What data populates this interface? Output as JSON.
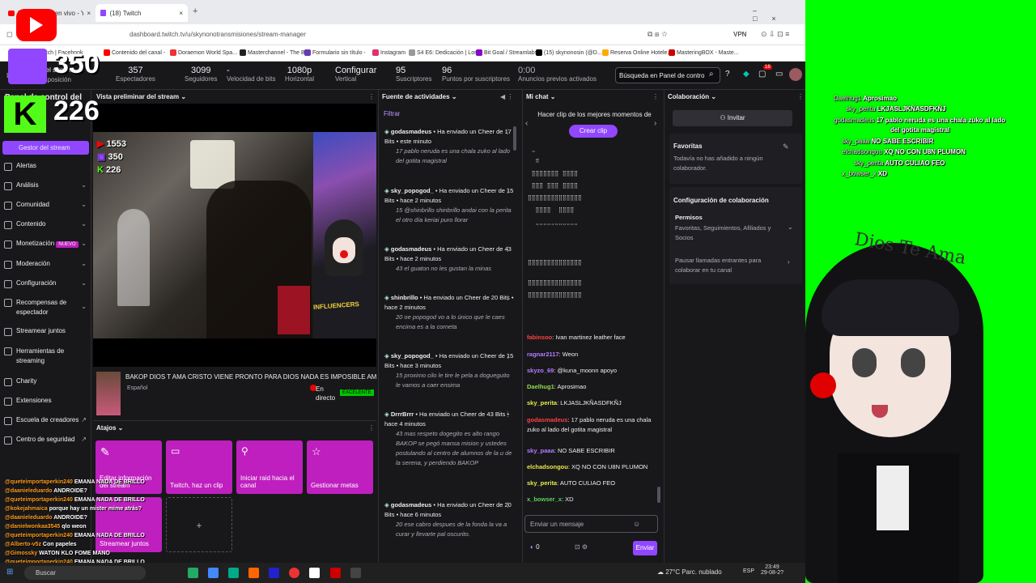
{
  "browser": {
    "tabs": [
      {
        "label": "Transmisión en vivo - YouTube"
      },
      {
        "label": "(18) Twitch"
      }
    ],
    "url": "dashboard.twitch.tv/u/skynonotransmisiones/stream-manager",
    "vpn": "VPN",
    "bookmarks": [
      "(22+) Watch | Facebook",
      "Contenido del canal -",
      "Doraemon World Spa...",
      "Masterchannel - The B...",
      "Formulario sin título -",
      "Instagram",
      "S4 E6: Dedicación | Los...",
      "Bit Goal / Streamlabs",
      "(15) skynonosin (@D...",
      "Reserva Online Hotele...",
      "MasteringBOX - Maste..."
    ]
  },
  "stream_counters": {
    "youtube": "1553",
    "twitch": "350",
    "kick": "226",
    "twitch_big": "350",
    "kick_big": "226"
  },
  "header": {
    "title_line1": "Gestor del stream",
    "title_line2": "Disposición",
    "stats": [
      {
        "value": "357",
        "label": "Espectadores"
      },
      {
        "value": "3099",
        "label": "Seguidores"
      },
      {
        "value": "-",
        "label": "Velocidad de bits"
      },
      {
        "value": "1080p",
        "label": "Horizontal"
      },
      {
        "value": "Configurar",
        "label": "Vertical"
      },
      {
        "value": "95",
        "label": "Suscriptores"
      },
      {
        "value": "96",
        "label": "Puntos por suscriptores"
      },
      {
        "value": "0:00",
        "label": "Anuncios previos activados"
      }
    ],
    "search_placeholder": "Búsqueda en Panel de contro",
    "notif_count": "18"
  },
  "sidebar": {
    "title": "Panel de control del creador",
    "items": [
      {
        "label": "Gestor del stream"
      },
      {
        "label": "Alertas"
      },
      {
        "label": "Análisis"
      },
      {
        "label": "Comunidad"
      },
      {
        "label": "Contenido"
      },
      {
        "label": "Monetización",
        "badge": "NUEVO"
      },
      {
        "label": "Moderación"
      },
      {
        "label": "Configuración"
      },
      {
        "label": "Recompensas de espectador"
      },
      {
        "label": "Streamear juntos"
      },
      {
        "label": "Herramientas de streaming"
      },
      {
        "label": "Charity"
      },
      {
        "label": "Extensiones"
      },
      {
        "label": "Escuela de creadores"
      },
      {
        "label": "Centro de seguridad"
      }
    ]
  },
  "preview": {
    "header": "Vista preliminar del stream",
    "watermark": "INFLUENCERS",
    "stream_title": "BAKOP DIOS T AMA CRISTO VIENE PRONTO PARA DIOS NADA ES IMPOSIBLE AMEN NUEVA",
    "language": "Español",
    "live": "En directo",
    "category_badge": "EXCELENTE"
  },
  "actions": {
    "header": "Atajos",
    "items": [
      {
        "label": "Editar información del stream"
      },
      {
        "label": "Twitch, haz un clip"
      },
      {
        "label": "Iniciar raid hacia el canal"
      },
      {
        "label": "Gestionar metas"
      },
      {
        "label": "Streamear juntos"
      }
    ]
  },
  "activity": {
    "header": "Fuente de actividades",
    "filter": "Filtrar",
    "events": [
      {
        "user": "godasmadeus",
        "text": "Ha enviado un Cheer de 17 Bits • este minuto",
        "msg": "17 pablo neruda es una chala zuko al lado del gotita magistral"
      },
      {
        "user": "sky_popogod_",
        "text": "Ha enviado un Cheer de 15 Bits • hace 2 minutos",
        "msg": "15 @shinbrillo shinbrillo andai con la perita el otro día keriai puro llorar"
      },
      {
        "user": "godasmadeus",
        "text": "Ha enviado un Cheer de 43 Bits • hace 2 minutos",
        "msg": "43 el guaton no les gustan la minas"
      },
      {
        "user": "shinbrillo",
        "text": "Ha enviado un Cheer de 20 Bits • hace 2 minutos",
        "msg": "20 oe popogod vo a lo único que le caes encima es a la corneta"
      },
      {
        "user": "sky_popogod_",
        "text": "Ha enviado un Cheer de 15 Bits • hace 3 minutos",
        "msg": "15 proximo cilo le tire le pela a dogueguito le vamos a caer ensima"
      },
      {
        "user": "DrrrBrrr",
        "text": "Ha enviado un Cheer de 43 Bits • hace 4 minutos",
        "msg": "43 mas respeto dogegito es alto rango BAKOP se pegó mansa mision y ustedes postulando al centro de alumnos de la u de la serena, y perdiendo BAKOP"
      },
      {
        "user": "godasmadeus",
        "text": "Ha enviado un Cheer de 20 Bits • hace 6 minutos",
        "msg": "20 ese cabro despues de la fonda la va a curar y llevarte pal oscurito."
      }
    ]
  },
  "chat": {
    "header": "Mi chat",
    "clip_prompt": "Hacer clip de los mejores momentos de",
    "clip_button": "Crear clip",
    "ascii": [
      "⠀⣀⠀⠀⠀⠀⠀⠀⠀⠀⠀⠀⠀⠀",
      "⠀⠀⠿⠀⠀⠀⠀⠀⠀⠀⠀⠀⠀",
      "⠀⣿⣿⣿⣿⣿⣿⣿⠀⣿⣿⣿⣿⠀",
      "⠀⣿⣿⣿⠀⣿⣿⣿⠀⣿⣿⣿⣿⠀",
      "⣿⣿⣿⣿⣿⣿⣿⣿⣿⣿⣿⣿⣿⣿",
      "⠀⠀⣿⣿⣿⣿⠀⠀⣿⣿⣿⣿⠀⠀",
      "⠀⠀⣀⣀⣀⣀⣀⣀⣀⣀⣀⣀⣀⠀",
      "⣿⣿⣿⣿⣿⣿⣿⣿⣿⣿⣿⣿⣿⣿",
      "⣿⣿⣿⣿⣿⣿⣿⣿⣿⣿⣿⣿⣿⣿",
      "⣿⣿⣿⣿⣿⣿⣿⣿⣿⣿⣿⣿⣿⣿"
    ],
    "messages": [
      {
        "user": "fabinsoo",
        "color": "#ff4040",
        "text": ": Ivan martinez leather face"
      },
      {
        "user": "ragnar2117",
        "color": "#b57bff",
        "text": ": Weon"
      },
      {
        "user": "skyzo_69",
        "color": "#b57bff",
        "text": ": @kuna_moonn apoyo"
      },
      {
        "user": "Daelhug1",
        "color": "#8fdc4e",
        "text": ": Aprosimao"
      },
      {
        "user": "sky_perita",
        "color": "#e8e84a",
        "text": ": LKJASLJKÑASDFKÑJ"
      },
      {
        "user": "godasmadeus",
        "color": "#ff4040",
        "text": ": 17 pablo neruda es una chala zuko al lado del gotita magistral"
      },
      {
        "user": "sky_paaa",
        "color": "#b57bff",
        "text": ": NO SABE ESCRIBIR"
      },
      {
        "user": "elchadsongou",
        "color": "#e8e84a",
        "text": ": XQ NO CON U8N PLUMON"
      },
      {
        "user": "sky_perita",
        "color": "#e8e84a",
        "text": ": AUTO CULIAO FEO"
      },
      {
        "user": "x_bowser_x",
        "color": "#5bd35b",
        "text": ": XD"
      }
    ],
    "input_placeholder": "Enviar un mensaje",
    "points": "0",
    "send": "Enviar"
  },
  "collab": {
    "header": "Colaboración",
    "invite": "Invitar",
    "favorites_title": "Favoritas",
    "favorites_empty": "Todavía no has añadido a ningún colaborador.",
    "config_title": "Configuración de colaboración",
    "perms_title": "Permisos",
    "perms_value": "Favoritas, Seguimientos, Afiliados y Socios",
    "pause_label": "Pausar llamadas entrantes para colaborar en tu canal"
  },
  "overlay": {
    "chat": [
      {
        "user": "Daelhug1",
        "text": "Aprosimao"
      },
      {
        "user": "sky_perita",
        "text": "LKJASLJKÑASDFKÑJ"
      },
      {
        "user": "godasmadeus",
        "text": "17 pablo neruda es una chala zuko al lado"
      },
      {
        "user": "",
        "text": "del gotita magistral"
      },
      {
        "user": "sky_paaa",
        "text": "NO SABE ESCRIBIR"
      },
      {
        "user": "elchadsongou",
        "text": "XQ NO CON U8N PLUMON"
      },
      {
        "user": "sky_perita",
        "text": "AUTO CULIAO FEO"
      },
      {
        "user": "x_bowser_x",
        "text": "XD"
      }
    ],
    "banner": "Dios Te Ama"
  },
  "bottom_chat": [
    {
      "user": "@queteimportaperkin240",
      "text": "EMANA NADA DE BRILLO"
    },
    {
      "user": "@daanieleduardo",
      "text": "ANDROIDE?"
    },
    {
      "user": "@queteimportaperkin240",
      "text": "EMANA NADA DE BRILLO"
    },
    {
      "user": "@kokejahmaica",
      "text": "porque hay un mister mime atrás?"
    },
    {
      "user": "@daanieleduardo",
      "text": "ANDROIDE?"
    },
    {
      "user": "@danielwonkaa3545",
      "text": "qlo weon"
    },
    {
      "user": "@queteimportaperkin240",
      "text": "EMANA NADA DE BRILLO"
    },
    {
      "user": "@Alberto-v5z",
      "text": "Con papeles"
    },
    {
      "user": "@Gimossky",
      "text": "WATON KLO FOME MANO"
    },
    {
      "user": "@queteimportaperkin240",
      "text": "EMANA NADA DE BRILLO"
    }
  ],
  "taskbar": {
    "search": "Buscar",
    "weather": "27°C  Parc. nublado",
    "lang": "ESP",
    "time": "23:49",
    "date": "29-08-2?"
  },
  "colors": {
    "twitch_purple": "#9147ff",
    "action_magenta": "#bf1fbf",
    "green_screen": "#00ff00",
    "bg": "#18181b"
  }
}
